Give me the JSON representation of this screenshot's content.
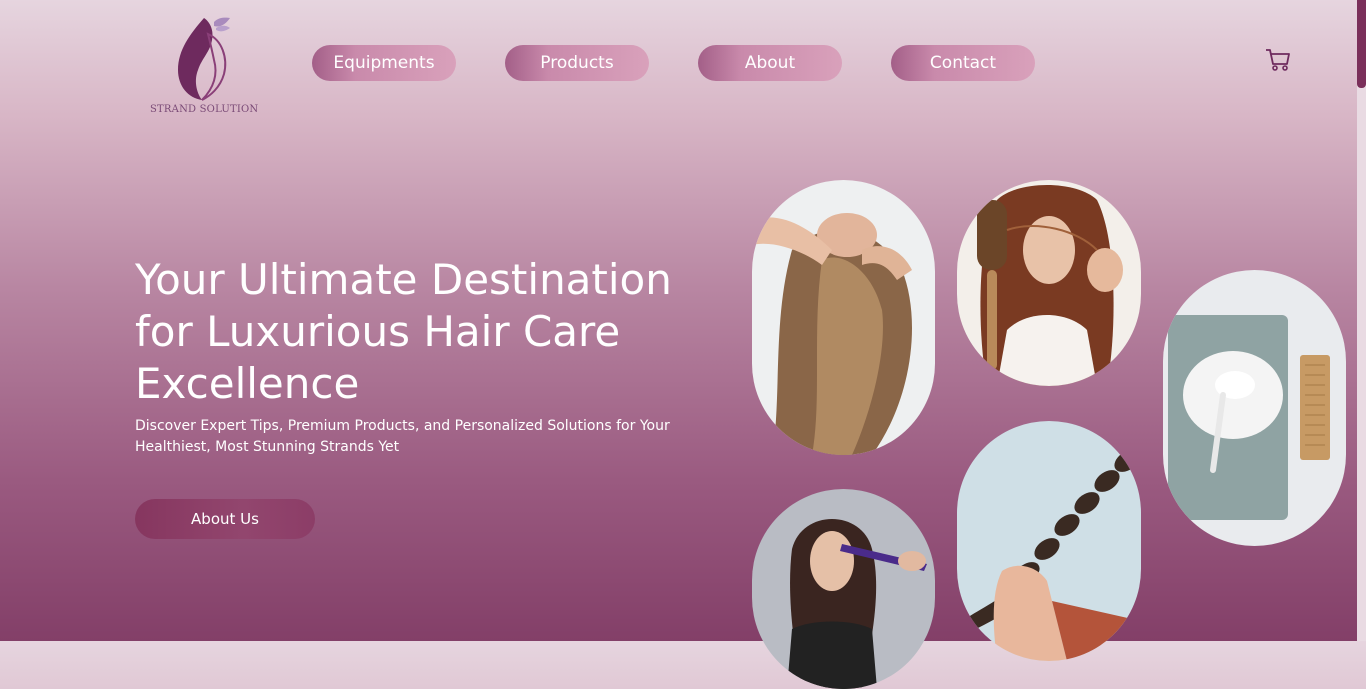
{
  "logo": {
    "text": "STRAND SOLUTION",
    "icon": "woman-profile-leaf-icon",
    "color": "#6e2a5e"
  },
  "nav": {
    "items": [
      {
        "label": "Equipments"
      },
      {
        "label": "Products"
      },
      {
        "label": "About"
      },
      {
        "label": "Contact"
      }
    ]
  },
  "cart": {
    "icon": "shopping-cart-icon"
  },
  "hero": {
    "title": "Your Ultimate Destination for Luxurious Hair Care Excellence",
    "subtitle": "Discover Expert Tips, Premium Products, and Personalized Solutions for Your Healthiest, Most Stunning Strands Yet",
    "cta_label": "About Us"
  },
  "gallery": [
    {
      "name": "woman-hair-flowing-photo"
    },
    {
      "name": "woman-brush-hair-loss-photo"
    },
    {
      "name": "towel-cream-comb-photo"
    },
    {
      "name": "woman-straightener-photo"
    },
    {
      "name": "hand-holding-braid-photo"
    }
  ],
  "colors": {
    "accent": "#7a2f5a",
    "button": "#d9a1bb"
  }
}
